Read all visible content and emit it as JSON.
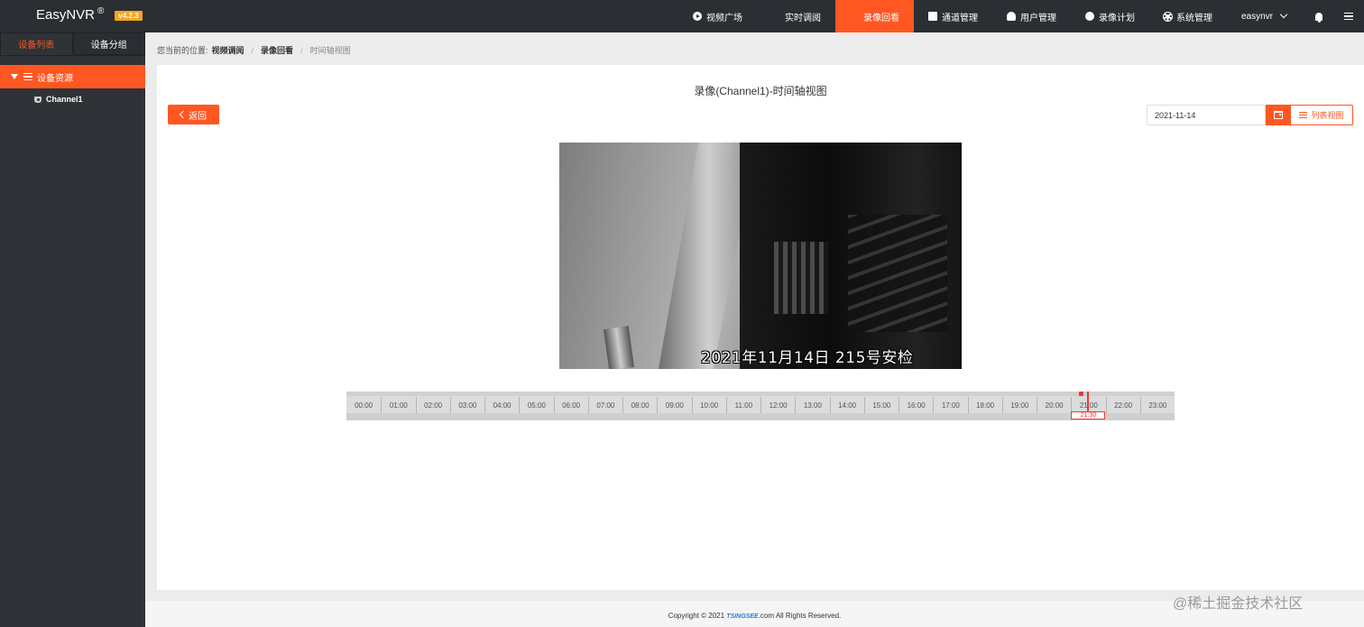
{
  "header": {
    "app_name": "EasyNVR",
    "reg_mark": "®",
    "version": "v4.2.3",
    "nav": [
      {
        "label": "视频广场",
        "icon": "play-circle-icon",
        "active": false
      },
      {
        "label": "实时调阅",
        "icon": "video-icon",
        "active": false
      },
      {
        "label": "录像回看",
        "icon": "video-icon",
        "active": true
      },
      {
        "label": "通道管理",
        "icon": "list-icon",
        "active": false
      },
      {
        "label": "用户管理",
        "icon": "user-icon",
        "active": false
      },
      {
        "label": "录像计划",
        "icon": "film-icon",
        "active": false
      },
      {
        "label": "系统管理",
        "icon": "gear-icon",
        "active": false
      }
    ],
    "username": "easynvr"
  },
  "sidebar": {
    "tabs": [
      "设备列表",
      "设备分组"
    ],
    "active_tab": 0,
    "tree_root": "设备资源",
    "channels": [
      "Channel1"
    ]
  },
  "breadcrumb": {
    "prefix": "您当前的位置:",
    "items": [
      "视频调阅",
      "录像回看",
      "时间轴视图"
    ]
  },
  "main": {
    "title": "录像(Channel1)-时间轴视图",
    "back_label": "返回",
    "date_value": "2021-11-14",
    "list_view_label": "列表视图"
  },
  "video": {
    "osd_text": "2021年11月14日  215号安检"
  },
  "timeline": {
    "hours": [
      "00:00",
      "01:00",
      "02:00",
      "03:00",
      "04:00",
      "05:00",
      "06:00",
      "07:00",
      "08:00",
      "09:00",
      "10:00",
      "11:00",
      "12:00",
      "13:00",
      "14:00",
      "15:00",
      "16:00",
      "17:00",
      "18:00",
      "19:00",
      "20:00",
      "21:00",
      "22:00",
      "23:00"
    ],
    "cursor_time": "21:30",
    "cursor_fraction": 0.8958,
    "record_marker_fraction": 0.8875
  },
  "footer": {
    "copyright_prefix": "Copyright © 2021",
    "brand": "TSINGSEE",
    "copyright_suffix": ".com All Rights Reserved."
  },
  "watermark": "@稀土掘金技术社区",
  "colors": {
    "accent": "#fe5722",
    "topbar": "#2b2e33",
    "sidebar": "#2f3237",
    "cursor": "#e53935"
  }
}
